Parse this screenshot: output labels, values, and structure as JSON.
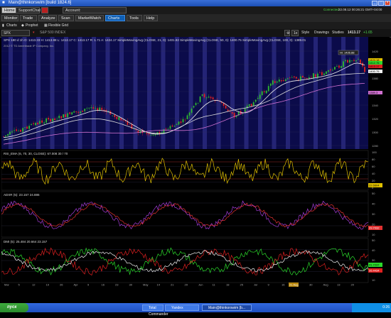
{
  "window": {
    "title": "Main@thinkorswim [build 1824.6]"
  },
  "tabs": {
    "home": "Home",
    "support_chat": "SupportChat",
    "account_label": "Account:",
    "status_connected": "Connected",
    "datetime": "22.08.12 00:26:21 GMT+04:00"
  },
  "menu": {
    "items": [
      "Monitor",
      "Trade",
      "Analyze",
      "Scan",
      "MarketWatch",
      "Charts",
      "Tools",
      "Help"
    ],
    "active": "Charts"
  },
  "subtabs": {
    "charts": "Charts",
    "prophet": "Prophet",
    "flexible_grid": "Flexible Grid"
  },
  "chart_toolbar": {
    "symbol": "SPX",
    "symbol_desc": "S&P 500 INDEX",
    "style": "Style",
    "drawings": "Drawings",
    "studies": "Studies",
    "price": "1413.17",
    "price_change": "+1.65"
  },
  "chart_header": {
    "line1": "SPX 180 d 1h    O: 1413.33  H: 1413.88  L: 1412.17  C: 1413.17  R: 1.71  A: 1424.17   SimpleMovingAvg (CLOSE, 21, 0): 1401.82   SimpleMovingAvg (CLOSE, 50, 0): 1400.75   SimpleMovingAvg (CLOSE, 100, 0): 1389.01",
    "line2": "2012 © TD Ameritrade IP Company, Inc."
  },
  "price_chart": {
    "hi_label": "Hi: 1426.88",
    "price_tags": [
      "1424.18",
      "1412.76",
      "1413.17",
      "1400.75",
      "1389.3"
    ],
    "yaxis_labels": [
      "1420",
      "1400",
      "1380",
      "1360",
      "1340",
      "1320",
      "1300",
      "1280"
    ]
  },
  "studies": {
    "rsi_label": "RSI_EMA (6, 70, 30, CLOSE): 67.008   30 / 70",
    "rsi_value": "22.6604",
    "rsi_yaxis": [
      "100",
      "80",
      "60",
      "40",
      "20",
      "0"
    ],
    "adx_label": "ADXR (5): 23.157   24.886",
    "adx_value": "29.7032",
    "adx_yaxis": [
      "50",
      "40",
      "30",
      "20",
      "10"
    ],
    "dmi_label": "DMI (5): 25.484   20.664   23.157",
    "dmi_values": [
      "41.7237",
      "26.4434"
    ],
    "dmi_yaxis": [
      "50",
      "40",
      "30",
      "20",
      "10"
    ]
  },
  "time_axis": {
    "labels": [
      "Mar",
      "5",
      "12",
      "19",
      "26",
      "Apr",
      "9",
      "16",
      "23",
      "30",
      "May",
      "14",
      "21",
      "29",
      "Jun",
      "11",
      "18",
      "25",
      "Jul",
      "9",
      "16",
      "23",
      "30",
      "Aug",
      "13",
      "20"
    ],
    "highlight": "21 Aug"
  },
  "taskbar": {
    "start": "пуск",
    "tasks": [
      "Total Commander",
      "Yandex",
      "Main@thinkorswim [b..."
    ],
    "tray_time": "0:26"
  },
  "colors": {
    "chart_bg": "#000000",
    "price_bg": "#0b0b4a",
    "grid": "#333355",
    "band": "#3a3a9a",
    "candle_up": "#2ebc2e",
    "candle_down": "#e02020",
    "sma21": "#f0f0f0",
    "sma50": "#d9d9d9",
    "sma100": "#d070d0",
    "rsi": "#e0c000",
    "adx": "#a23bd6",
    "adxr": "#e03030",
    "dmi_plus": "#2bd82b",
    "dmi_minus": "#e02020",
    "dmi_adx": "#f0f0f0"
  }
}
